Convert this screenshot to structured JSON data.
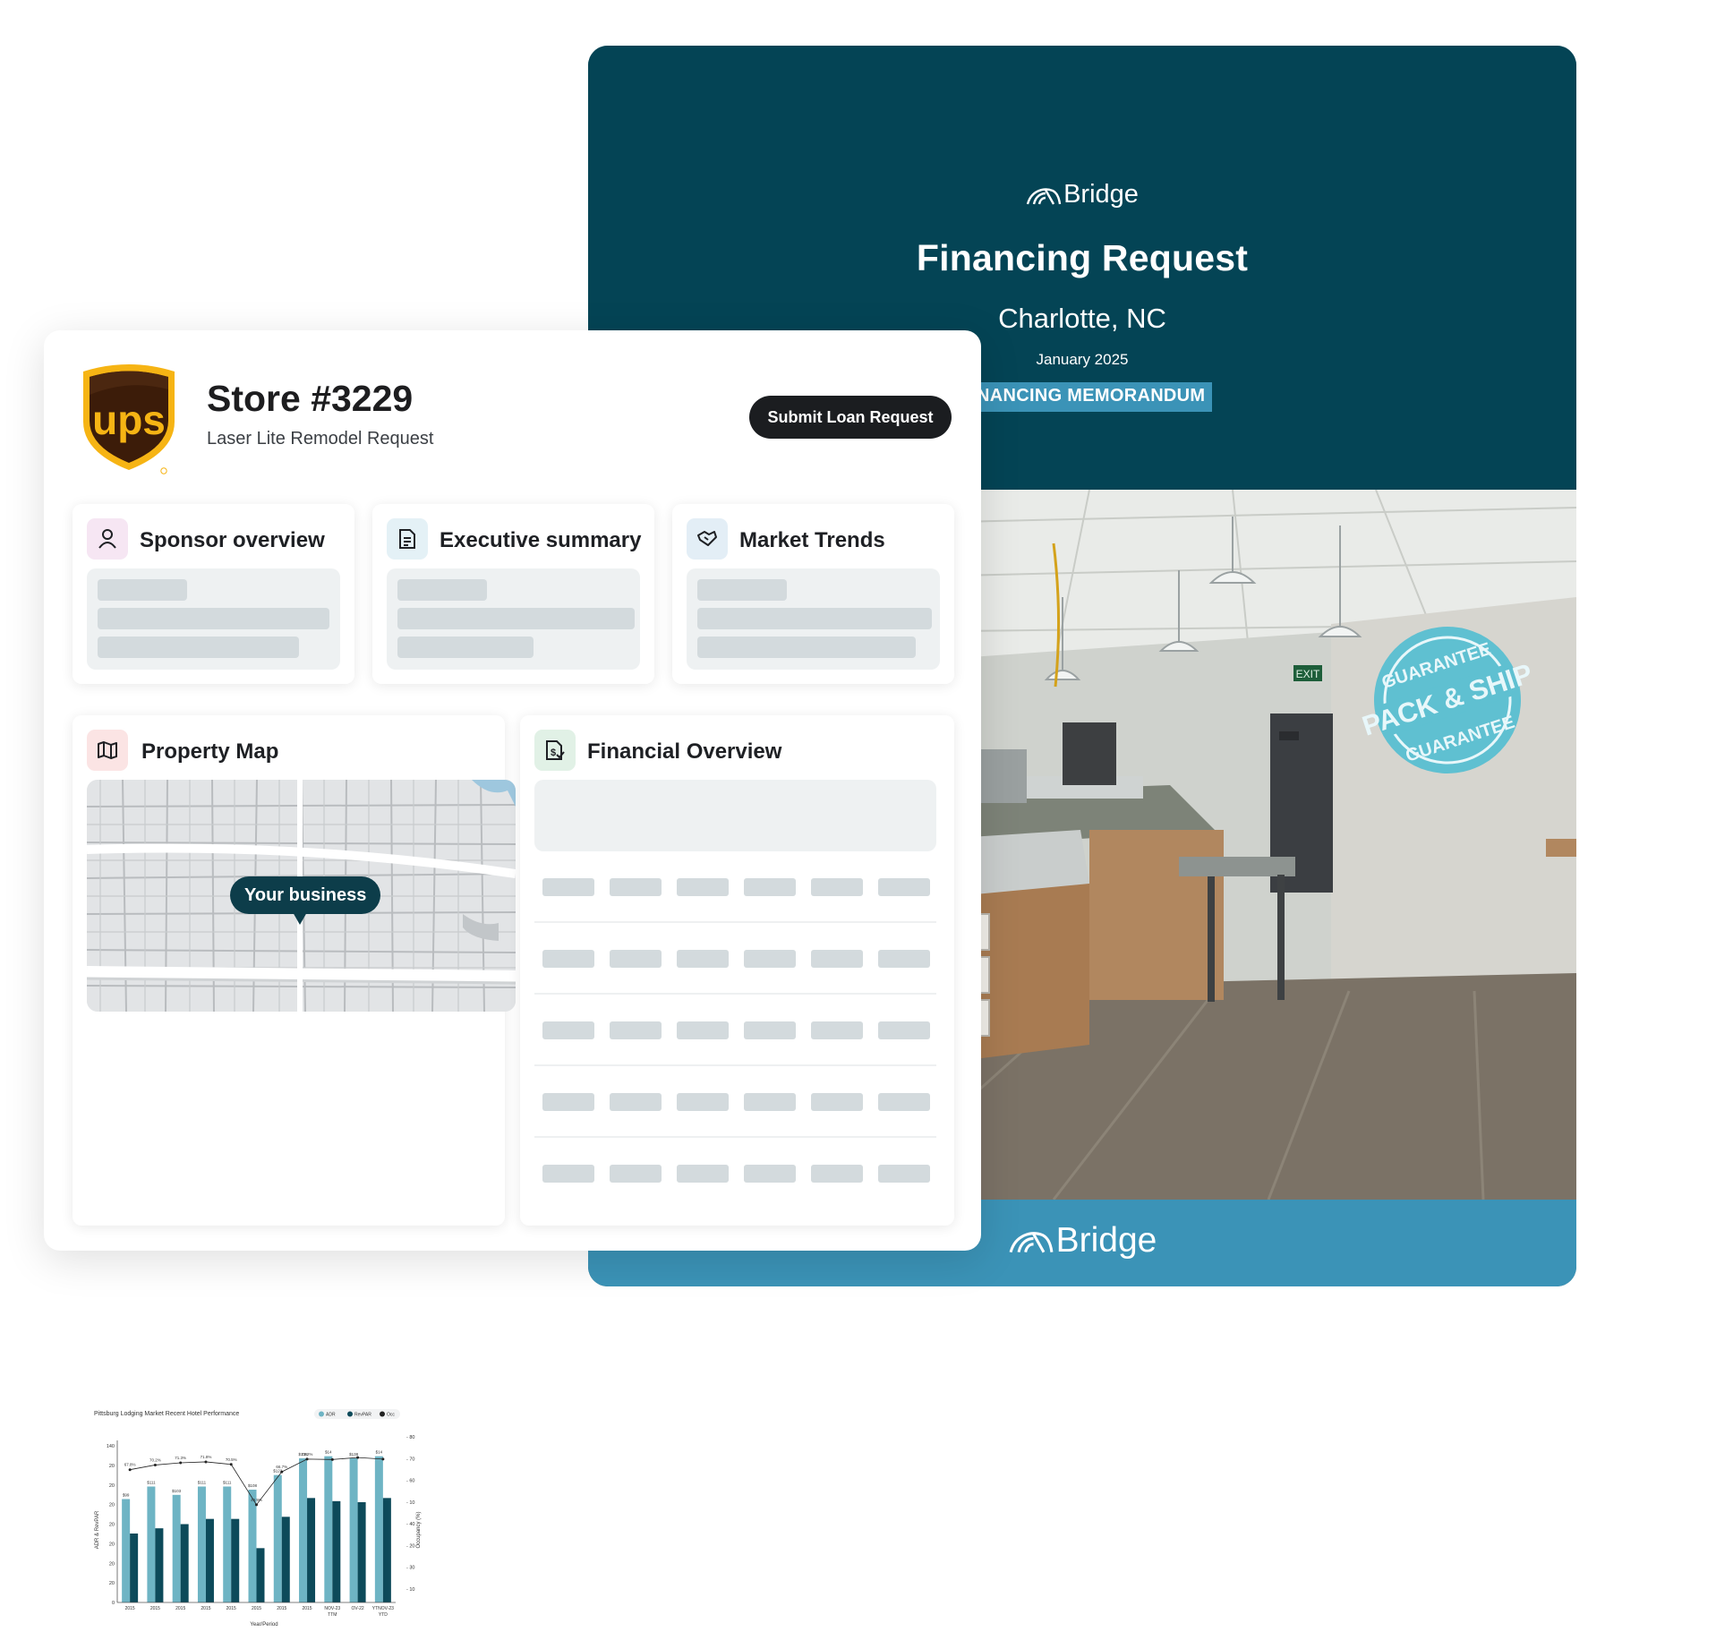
{
  "memo": {
    "brand": "Bridge",
    "title": "Financing Request",
    "city": "Charlotte, NC",
    "date": "January 2025",
    "tag": "NANCING MEMORANDUM",
    "photo_sign": {
      "top": "GUARANTEE",
      "middle": "PACK & SHIP",
      "bottom": "GUARANTEE"
    },
    "exit_sign": "EXIT",
    "footer_brand": "Bridge"
  },
  "store": {
    "logo_text": "ups",
    "name": "Store #3229",
    "subtitle": "Laser Lite Remodel Request",
    "submit_label": "Submit Loan Request",
    "panels": {
      "sponsor": "Sponsor overview",
      "executive": "Executive summary",
      "market": "Market Trends",
      "map": "Property Map",
      "financial": "Financial Overview"
    },
    "map_callout": "Your business"
  },
  "colors": {
    "teal_dark": "#044455",
    "teal_light": "#3b93b7",
    "bar_light": "#6eb4c4",
    "bar_dark": "#0d4a5a",
    "ups_brown": "#3c1c09",
    "ups_gold": "#f6b414"
  },
  "chart_data": {
    "type": "bar",
    "title": "Pittsburg Lodging Market Recent Hotel Performance",
    "legend": [
      "ADR",
      "RevPAR",
      "Occ"
    ],
    "categories": [
      "2015",
      "2015",
      "2015",
      "2015",
      "2015",
      "2015",
      "2015",
      "2015",
      "NOV-23 TTM",
      "OV-22",
      "YTNOV-23 YTD"
    ],
    "xlabel": "Year/Period",
    "ylabel": "ADR & RevPAR",
    "y2label": "Occupancy (%)",
    "left_ticks": [
      "140",
      "20",
      "20",
      "20",
      "20",
      "20",
      "20",
      "20",
      "0"
    ],
    "right_ticks": [
      "80",
      "70",
      "60",
      "10",
      "40",
      "20",
      "30",
      "10"
    ],
    "series": [
      {
        "name": "ADR",
        "values": [
          99,
          111,
          103,
          111,
          111,
          108,
          122,
          138,
          140,
          138,
          140
        ]
      },
      {
        "name": "RevPAR",
        "values": [
          66,
          71,
          75,
          80,
          80,
          52,
          82,
          100,
          97,
          96,
          100
        ]
      },
      {
        "name": "Occ",
        "values": [
          67.8,
          70.2,
          71.3,
          71.8,
          70.5,
          49.9,
          66.7,
          73.2,
          73.0,
          74.0,
          73.2
        ]
      }
    ],
    "bar_labels": [
      "$99",
      "$111",
      "$103",
      "$111",
      "$111",
      "$108",
      "$122",
      "$138",
      "$14",
      "$138",
      "$14"
    ],
    "occ_labels": [
      "67.8%",
      "70.2%",
      "71.3%",
      "71.8%",
      "70.5%",
      "49.9%",
      "66.7%",
      "73.2%",
      "",
      "",
      ""
    ],
    "ylim": [
      0,
      150
    ],
    "y2lim": [
      0,
      80
    ]
  }
}
